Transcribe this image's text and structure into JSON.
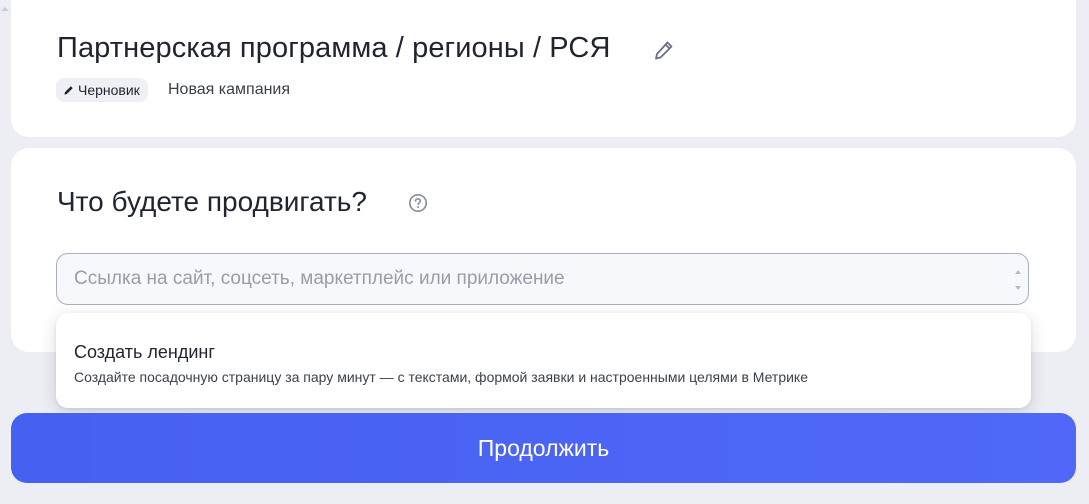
{
  "header": {
    "title": "Партнерская программа / регионы / РСЯ",
    "status_badge": "Черновик",
    "campaign_name": "Новая кампания",
    "edit_icon": "pencil-icon"
  },
  "promote": {
    "title": "Что будете продвигать?",
    "help_icon": "question-circle-icon",
    "input_value": "",
    "input_placeholder": "Ссылка на сайт, соцсеть, маркетплейс или приложение"
  },
  "suggestions": [
    {
      "title": "Создать лендинг",
      "description": "Создайте посадочную страницу за пару минут — с текстами, формой заявки и настроенными целями в Метрике"
    }
  ],
  "footer": {
    "continue_label": "Продолжить"
  },
  "colors": {
    "accent": "#4760f2",
    "page_bg": "#eceef3",
    "card_bg": "#ffffff",
    "badge_bg": "#eef0f4"
  }
}
